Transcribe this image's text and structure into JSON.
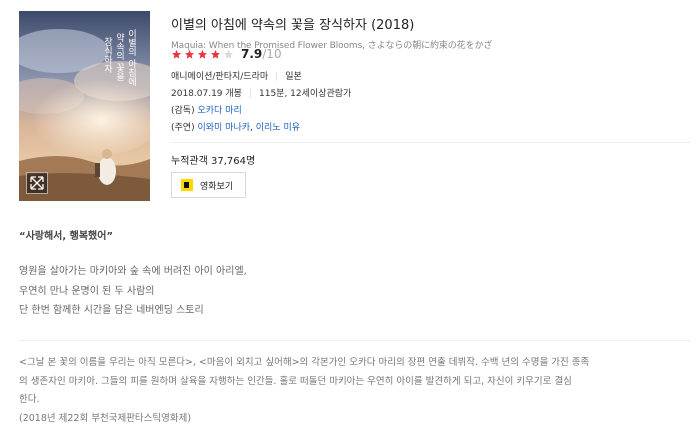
{
  "movie": {
    "title": "이별의 아침에 약속의 꽃을 장식하자",
    "year": "(2018)",
    "subtitle": "Maquia: When the Promised Flower Blooms, さよならの朝に約束の花をかざ",
    "rating": {
      "value": "7.9",
      "max": "/10",
      "stars_filled": 4,
      "stars_total": 5
    },
    "genre": "애니메이션/판타지/드라마",
    "country": "일본",
    "release": "2018.07.19 개봉",
    "runtime_rating": "115분, 12세이상관람가",
    "director_label": "(감독)",
    "director": "오카다 마리",
    "cast_label": "(주연)",
    "cast": [
      "이와미 마나카",
      "이리노 미유"
    ],
    "cast_separator": ", ",
    "audience": "누적관객 37,764명",
    "watch_button": "영화보기"
  },
  "poster": {
    "vertical_text": [
      "이별의 아침에",
      "약속의 꽃을",
      "장식하자"
    ]
  },
  "tagline": "“사랑해서, 행복했어”",
  "synopsis": [
    "영원을 살아가는 마키아와 숲 속에 버려진 아이 아리엘,",
    "우연히 만나 운명이 된 두 사람의",
    "단 한번 함께한 시간을 담은 네버엔딩 스토리"
  ],
  "description": [
    "<그날 본 꽃의 이름을 우리는 아직 모른다>, <마음이 외치고 싶어해>의 각본가인 오카다 마리의 장편 연출 데뷔작. 수백 년의 수명을 가진 종족",
    "의 생존자인 마키아. 그들의 피를 원하며 살육을 자행하는 인간들. 홀로 떠돌던 마키아는 우연히 아이를 발견하게 되고, 자신이 키우기로 결심",
    "한다.",
    "(2018년 제22회 부천국제판타스틱영화제)"
  ],
  "colors": {
    "star": "#ea3545",
    "link": "#1a5fbf",
    "watch_logo": "#ffd700"
  }
}
